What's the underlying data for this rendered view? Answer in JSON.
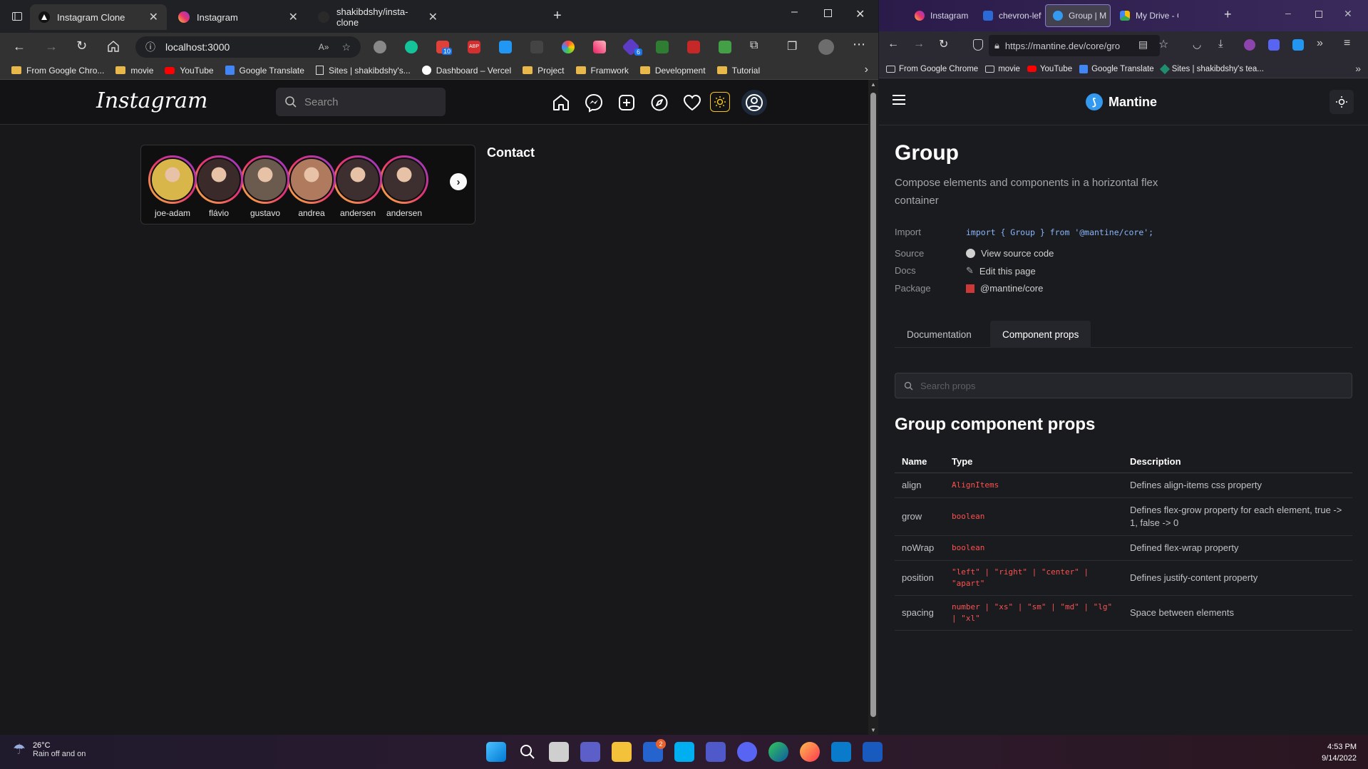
{
  "edge": {
    "tabs": [
      {
        "title": "Instagram Clone",
        "active": true
      },
      {
        "title": "Instagram",
        "active": false
      },
      {
        "title": "shakibdshy/insta-clone",
        "active": false
      }
    ],
    "url": "localhost:3000",
    "extension_badges": {
      "grammarly_count": "10",
      "ext_count": "6"
    },
    "bookmarks": [
      {
        "label": "From Google Chro...",
        "icon": "folder-icon"
      },
      {
        "label": "movie",
        "icon": "folder-icon"
      },
      {
        "label": "YouTube",
        "icon": "youtube-icon"
      },
      {
        "label": "Google Translate",
        "icon": "translate-icon"
      },
      {
        "label": "Sites | shakibdshy's...",
        "icon": "page-icon"
      },
      {
        "label": "Dashboard – Vercel",
        "icon": "vercel-icon"
      },
      {
        "label": "Project",
        "icon": "folder-icon"
      },
      {
        "label": "Framwork",
        "icon": "folder-icon"
      },
      {
        "label": "Development",
        "icon": "folder-icon"
      },
      {
        "label": "Tutorial",
        "icon": "folder-icon"
      }
    ]
  },
  "instagram": {
    "logo": "Instagram",
    "search_placeholder": "Search",
    "nav_icons": [
      "home-icon",
      "messenger-icon",
      "add-post-icon",
      "explore-icon",
      "heart-icon",
      "theme-toggle-icon",
      "profile-icon"
    ],
    "stories": [
      {
        "name": "joe-adam",
        "color": "#d9b64a"
      },
      {
        "name": "flávio",
        "color": "#3a2a2a"
      },
      {
        "name": "gustavo",
        "color": "#6b5a4e"
      },
      {
        "name": "andrea",
        "color": "#b07a5e"
      },
      {
        "name": "andersen",
        "color": "#3d2f2f"
      },
      {
        "name": "andersen",
        "color": "#3d2f2f"
      }
    ],
    "contact_title": "Contact"
  },
  "firefox": {
    "tabs": [
      {
        "title": "Instagram",
        "active": false
      },
      {
        "title": "chevron-left",
        "active": false
      },
      {
        "title": "Group | M",
        "active": true
      },
      {
        "title": "My Drive - G",
        "active": false
      }
    ],
    "url": "https://mantine.dev/core/gro",
    "bookmarks": [
      "From Google Chrome",
      "movie",
      "YouTube",
      "Google Translate",
      "Sites | shakibdshy's tea..."
    ]
  },
  "mantine": {
    "brand": "Mantine",
    "title": "Group",
    "subtitle": "Compose elements and components in a horizontal flex container",
    "meta": {
      "import_label": "Import",
      "import_value": "import { Group } from '@mantine/core';",
      "source_label": "Source",
      "source_value": "View source code",
      "docs_label": "Docs",
      "docs_value": "Edit this page",
      "package_label": "Package",
      "package_value": "@mantine/core"
    },
    "tabs": [
      {
        "label": "Documentation",
        "active": false
      },
      {
        "label": "Component props",
        "active": true
      }
    ],
    "search_props_placeholder": "Search props",
    "props_heading": "Group component props",
    "table": {
      "headers": [
        "Name",
        "Type",
        "Description"
      ],
      "rows": [
        {
          "name": "align",
          "type": "AlignItems",
          "description": "Defines align-items css property"
        },
        {
          "name": "grow",
          "type": "boolean",
          "description": "Defines flex-grow property for each element, true -> 1, false -> 0"
        },
        {
          "name": "noWrap",
          "type": "boolean",
          "description": "Defined flex-wrap property"
        },
        {
          "name": "position",
          "type": "\"left\" | \"right\" | \"center\" | \"apart\"",
          "description": "Defines justify-content property"
        },
        {
          "name": "spacing",
          "type": "number | \"xs\" | \"sm\" | \"md\" | \"lg\" | \"xl\"",
          "description": "Space between elements"
        }
      ]
    }
  },
  "taskbar": {
    "weather_temp": "26°C",
    "weather_desc": "Rain off and on",
    "apps": [
      "windows-start-icon",
      "search-icon",
      "task-view-icon",
      "chat-icon",
      "file-explorer-icon",
      "todo-icon",
      "skype-icon",
      "teams-icon",
      "discord-icon",
      "edge-icon",
      "firefox-icon",
      "vscode-icon",
      "word-icon"
    ],
    "badges": {
      "todo": "2"
    },
    "time": "4:53 PM",
    "date": "9/14/2022"
  },
  "colors": {
    "ig_bg": "#18181b",
    "mantine_bg": "#1a1b1e",
    "mantine_accent": "#339af0",
    "type_red": "#fa5252",
    "story_ring": "#e8336d"
  }
}
